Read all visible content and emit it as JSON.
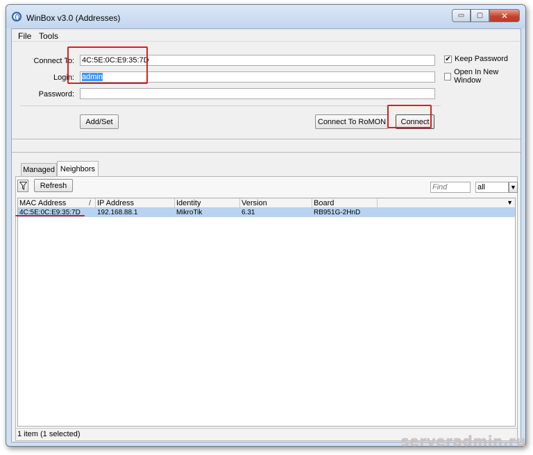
{
  "window": {
    "title": "WinBox v3.0 (Addresses)",
    "controls": {
      "minimize": "▭",
      "maximize": "▢",
      "close": "✕"
    }
  },
  "menu": {
    "file": "File",
    "tools": "Tools"
  },
  "form": {
    "connect_to_label": "Connect To:",
    "connect_to_value": "4C:5E:0C:E9:35:7D",
    "login_label": "Login:",
    "login_value": "admin",
    "password_label": "Password:",
    "password_value": "",
    "keep_password_label": "Keep Password",
    "keep_password_checked": "✔",
    "new_window_label": "Open In New Window"
  },
  "buttons": {
    "add_set": "Add/Set",
    "connect_romon": "Connect To RoMON",
    "connect": "Connect"
  },
  "tabs": {
    "managed": "Managed",
    "neighbors": "Neighbors"
  },
  "toolbar": {
    "filter_icon": "funnel-icon",
    "refresh": "Refresh",
    "find_placeholder": "Find",
    "scope_value": "all"
  },
  "table": {
    "headers": {
      "mac": "MAC Address",
      "mac_sort": "/",
      "ip": "IP Address",
      "identity": "Identity",
      "version": "Version",
      "board": "Board"
    },
    "rows": [
      {
        "mac": "4C:5E:0C:E9:35:7D",
        "ip": "192.168.88.1",
        "identity": "MikroTik",
        "version": "6.31",
        "board": "RB951G-2HnD"
      }
    ]
  },
  "status": {
    "text": "1 item (1 selected)"
  },
  "watermark": "serveradmin.ru",
  "colors": {
    "highlight": "#d91e1e",
    "selection": "#3399ff",
    "row_selected": "#b8d3f2"
  }
}
